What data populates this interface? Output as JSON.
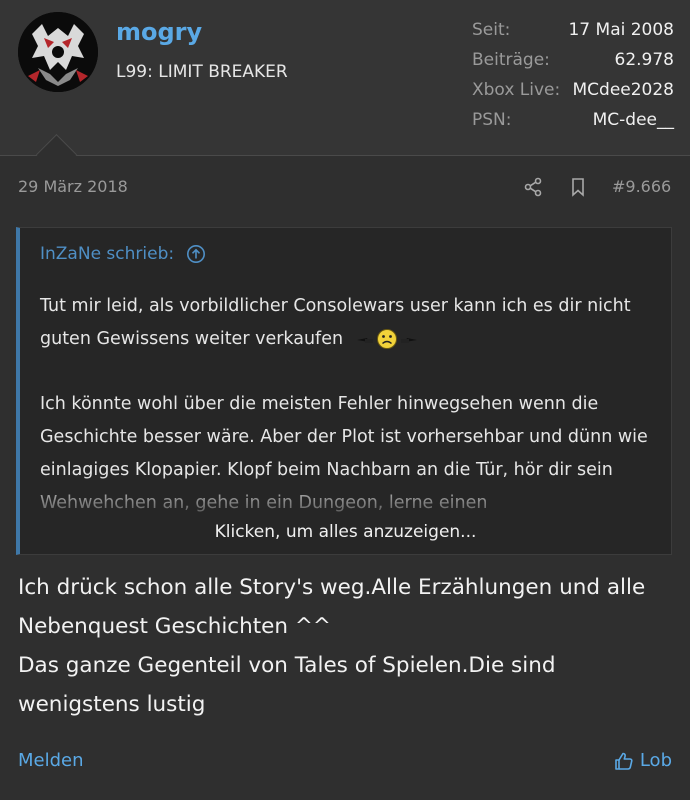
{
  "author": {
    "name": "mogry",
    "title": "L99: LIMIT BREAKER",
    "stats": [
      {
        "label": "Seit:",
        "value": "17 Mai 2008"
      },
      {
        "label": "Beiträge:",
        "value": "62.978"
      },
      {
        "label": "Xbox Live:",
        "value": "MCdee2028"
      },
      {
        "label": "PSN:",
        "value": "MC-dee__"
      }
    ]
  },
  "post": {
    "date": "29 März 2018",
    "number": "#9.666",
    "icons": {
      "share": "share-icon",
      "bookmark": "bookmark-icon"
    }
  },
  "quote": {
    "author_line": "InZaNe schrieb:",
    "paragraphs": [
      "Tut mir leid, als vorbildlicher Consolewars user kann ich es dir nicht guten Gewissens weiter verkaufen",
      "Ich könnte wohl über die meisten Fehler hinwegsehen wenn die Geschichte besser wäre. Aber der Plot ist vorhersehbar und dünn wie einlagiges Klopapier. Klopf beim Nachbarn an die Tür, hör dir sein Wehwehchen an, gehe in ein Dungeon, lerne einen"
    ],
    "expand_label": "Klicken, um alles anzuzeigen..."
  },
  "message": {
    "lines": [
      "Ich drück schon alle Story's weg.Alle Erzählungen und alle",
      "Nebenquest Geschichten ^^",
      "Das ganze Gegenteil von Tales of Spielen.Die sind",
      "wenigstens lustig"
    ]
  },
  "actions": {
    "report": "Melden",
    "like": "Lob"
  },
  "colors": {
    "accent": "#5aa9e6",
    "quote_border": "#3f78a8",
    "background": "#2f2f2f"
  }
}
